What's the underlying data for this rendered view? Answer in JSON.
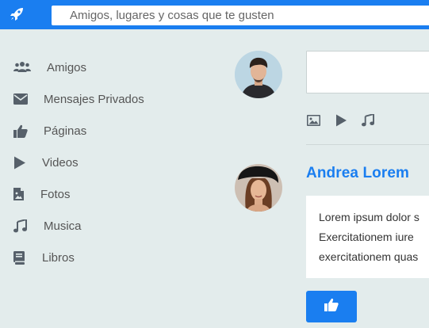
{
  "header": {
    "logo_icon": "rocket-icon",
    "search_placeholder": "Amigos, lugares y cosas que te gusten",
    "brand_color": "#1a7ef0"
  },
  "sidebar": {
    "items": [
      {
        "label": "Amigos",
        "icon": "users-icon"
      },
      {
        "label": "Mensajes Privados",
        "icon": "envelope-icon"
      },
      {
        "label": "Páginas",
        "icon": "thumbs-up-icon"
      },
      {
        "label": "Videos",
        "icon": "play-icon"
      },
      {
        "label": "Fotos",
        "icon": "file-image-icon"
      },
      {
        "label": "Musica",
        "icon": "music-icon"
      },
      {
        "label": "Libros",
        "icon": "book-icon"
      }
    ]
  },
  "composer": {
    "value": "",
    "tools": [
      "image-icon",
      "play-icon",
      "music-icon"
    ]
  },
  "post": {
    "author": "Andrea Lorem",
    "lines": [
      "Lorem ipsum dolor s",
      "Exercitationem iure",
      "exercitationem quas"
    ],
    "like_icon": "thumbs-up-icon"
  }
}
